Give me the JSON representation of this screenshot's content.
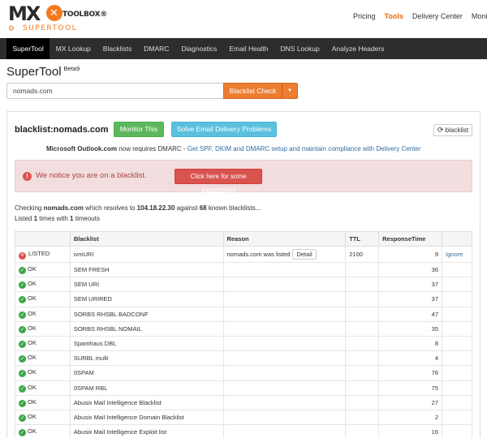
{
  "brand": {
    "logo_mx": "MX",
    "logo_toolbox": "TOOLBOX®",
    "logo_supertool": "SUPERTOOL"
  },
  "topnav": [
    "Pricing",
    "Tools",
    "Delivery Center",
    "Monitoring"
  ],
  "topnav_active": "Tools",
  "mainnav": [
    "SuperTool",
    "MX Lookup",
    "Blacklists",
    "DMARC",
    "Diagnostics",
    "Email Health",
    "DNS Lookup",
    "Analyze Headers"
  ],
  "mainnav_active": "SuperTool",
  "page": {
    "title": "SuperTool",
    "badge": "Beta9"
  },
  "search": {
    "value": "nomads.com",
    "button": "Blacklist Check",
    "caret": "▼"
  },
  "result": {
    "heading": "blacklist:nomads.com",
    "monitor_button": "Monitor This",
    "solve_button": "Solve Email Delivery Problems",
    "blacklist_button": "blacklist",
    "notice_bold": "Microsoft Outlook.com",
    "notice_text": " now requires DMARC - ",
    "notice_link": "Get SPF, DKIM and DMARC setup and maintain compliance with Delivery Center",
    "alert_text": "We notice you are on a blacklist.",
    "alert_button": "Click here for some suggestions",
    "check_prefix": "Checking ",
    "check_domain": "nomads.com",
    "check_mid": " which resolves to ",
    "check_ip": "104.18.22.30",
    "check_mid2": " against ",
    "check_count": "68",
    "check_suffix": " known blacklists...",
    "listed_prefix": "Listed ",
    "listed_count": "1",
    "listed_mid": " times with ",
    "timeouts_count": "1",
    "listed_suffix": " timeouts"
  },
  "table": {
    "headers": [
      "",
      "Blacklist",
      "Reason",
      "TTL",
      "ResponseTime",
      ""
    ],
    "rows": [
      {
        "status": "LISTED",
        "name": "ivmURI",
        "reason": "nomads.com was listed",
        "detail": "Detail",
        "ttl": "2100",
        "response": "9",
        "action": "Ignore"
      },
      {
        "status": "OK",
        "name": "SEM FRESH",
        "response": "36"
      },
      {
        "status": "OK",
        "name": "SEM URI",
        "response": "37"
      },
      {
        "status": "OK",
        "name": "SEM URIRED",
        "response": "37"
      },
      {
        "status": "OK",
        "name": "SORBS RHSBL BADCONF",
        "response": "47"
      },
      {
        "status": "OK",
        "name": "SORBS RHSBL NOMAIL",
        "response": "35"
      },
      {
        "status": "OK",
        "name": "Spamhaus DBL",
        "response": "8"
      },
      {
        "status": "OK",
        "name": "SURBL multi",
        "response": "4"
      },
      {
        "status": "OK",
        "name": "0SPAM",
        "response": "76"
      },
      {
        "status": "OK",
        "name": "0SPAM RBL",
        "response": "75"
      },
      {
        "status": "OK",
        "name": "Abusix Mail Intelligence Blacklist",
        "response": "27"
      },
      {
        "status": "OK",
        "name": "Abusix Mail Intelligence Domain Blacklist",
        "response": "2"
      },
      {
        "status": "OK",
        "name": "Abusix Mail Intelligence Exploit list",
        "response": "16"
      }
    ]
  },
  "colors": {
    "brand_orange": "#ed7d31",
    "ok_green": "#3ea54a",
    "listed_red": "#d9534f",
    "nav_dark": "#2d2d2d"
  }
}
